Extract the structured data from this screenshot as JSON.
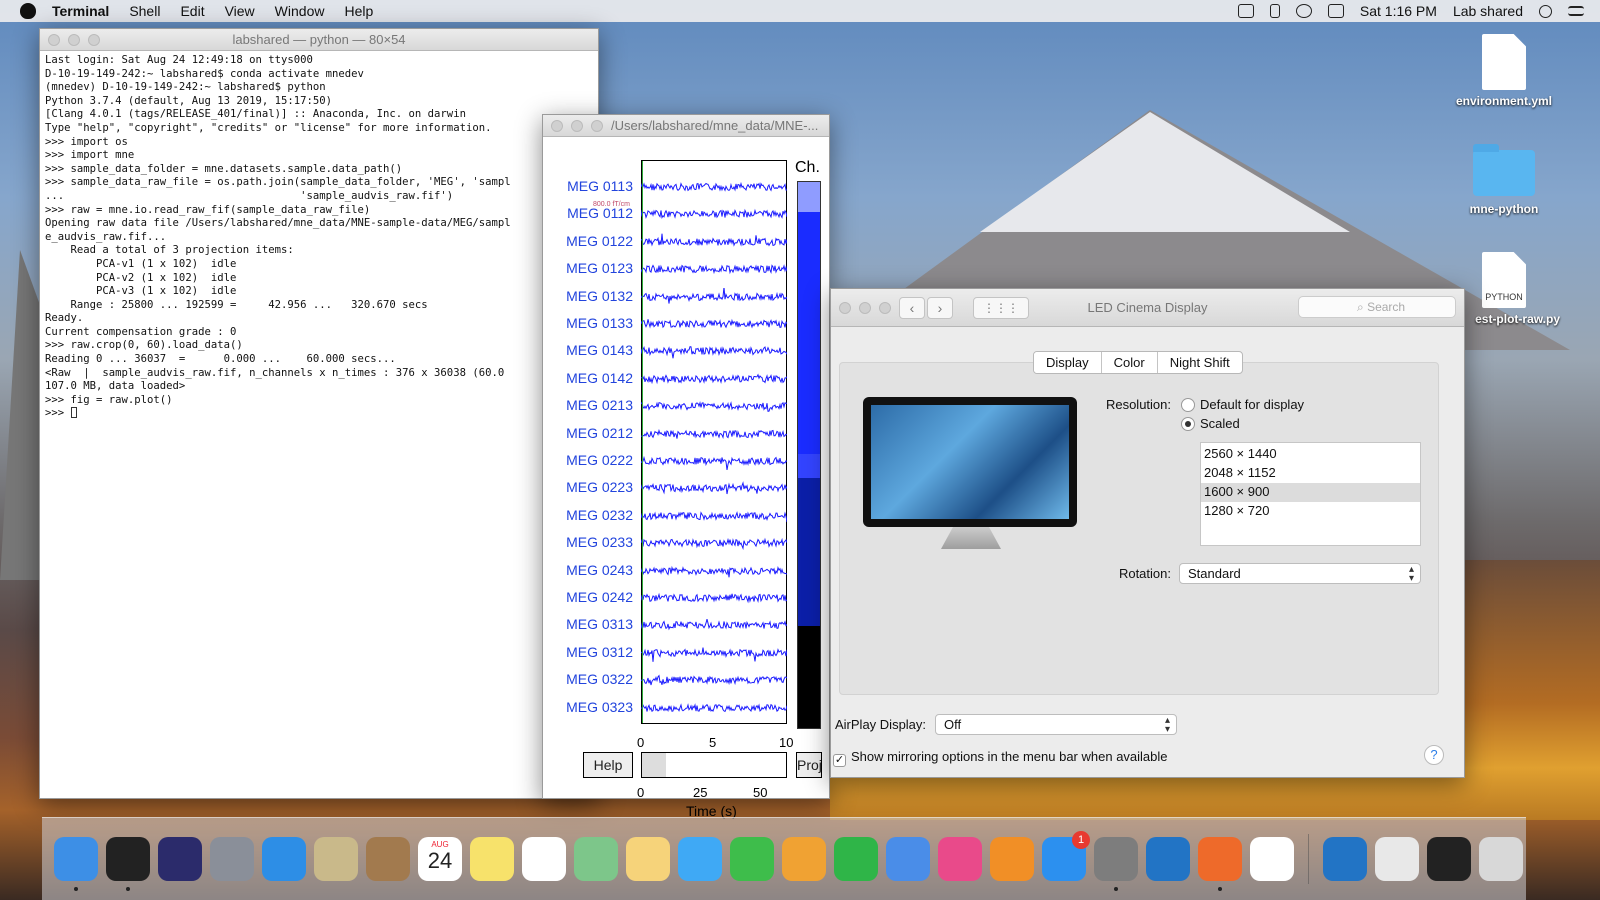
{
  "menubar": {
    "app_name": "Terminal",
    "items": [
      "Shell",
      "Edit",
      "View",
      "Window",
      "Help"
    ],
    "clock": "Sat 1:16 PM",
    "user": "Lab shared",
    "status_icons": [
      "shield-icon",
      "bluetooth-icon",
      "wifi-icon",
      "airplay-icon",
      "search-icon",
      "menu-list-icon"
    ]
  },
  "desktop": {
    "items": [
      {
        "label": "environment.yml",
        "icon": "file-icon"
      },
      {
        "label": "mne-python",
        "icon": "folder-icon"
      },
      {
        "label": "est-plot-raw.py",
        "icon": "python-file-icon",
        "tag": "PYTHON"
      }
    ]
  },
  "terminal": {
    "title": "labshared — python — 80×54",
    "lines": [
      "Last login: Sat Aug 24 12:49:18 on ttys000",
      "D-10-19-149-242:~ labshared$ conda activate mnedev",
      "(mnedev) D-10-19-149-242:~ labshared$ python",
      "Python 3.7.4 (default, Aug 13 2019, 15:17:50)",
      "[Clang 4.0.1 (tags/RELEASE_401/final)] :: Anaconda, Inc. on darwin",
      "Type \"help\", \"copyright\", \"credits\" or \"license\" for more information.",
      ">>> import os",
      ">>> import mne",
      ">>> sample_data_folder = mne.datasets.sample.data_path()",
      ">>> sample_data_raw_file = os.path.join(sample_data_folder, 'MEG', 'sampl",
      "...                                     'sample_audvis_raw.fif')",
      ">>> raw = mne.io.read_raw_fif(sample_data_raw_file)",
      "Opening raw data file /Users/labshared/mne_data/MNE-sample-data/MEG/sampl",
      "e_audvis_raw.fif...",
      "    Read a total of 3 projection items:",
      "        PCA-v1 (1 x 102)  idle",
      "        PCA-v2 (1 x 102)  idle",
      "        PCA-v3 (1 x 102)  idle",
      "    Range : 25800 ... 192599 =     42.956 ...   320.670 secs",
      "Ready.",
      "Current compensation grade : 0",
      ">>> raw.crop(0, 60).load_data()",
      "Reading 0 ... 36037  =      0.000 ...    60.000 secs...",
      "<Raw  |  sample_audvis_raw.fif, n_channels x n_times : 376 x 36038 (60.0",
      "107.0 MB, data loaded>",
      ">>> fig = raw.plot()",
      ">>> "
    ]
  },
  "mne_plot": {
    "title": "/Users/labshared/mne_data/MNE-...",
    "channels": [
      "MEG 0113",
      "MEG 0112",
      "MEG 0122",
      "MEG 0123",
      "MEG 0132",
      "MEG 0133",
      "MEG 0143",
      "MEG 0142",
      "MEG 0213",
      "MEG 0212",
      "MEG 0222",
      "MEG 0223",
      "MEG 0232",
      "MEG 0233",
      "MEG 0243",
      "MEG 0242",
      "MEG 0313",
      "MEG 0312",
      "MEG 0322",
      "MEG 0323"
    ],
    "scale_label": "800.0 fT/cm",
    "channel_header": "Ch.",
    "top_ticks": [
      "0",
      "5",
      "10"
    ],
    "bottom_ticks": [
      "0",
      "25",
      "50"
    ],
    "xlabel": "Time (s)",
    "help_label": "Help",
    "proj_label": "Proj",
    "trace_color": "#1a1aff"
  },
  "displays": {
    "title": "LED Cinema Display",
    "search_placeholder": "Search",
    "tabs": [
      "Display",
      "Color",
      "Night Shift"
    ],
    "active_tab": "Display",
    "resolution_label": "Resolution:",
    "resolution_options": [
      {
        "label": "Default for display",
        "checked": false
      },
      {
        "label": "Scaled",
        "checked": true
      }
    ],
    "resolutions": [
      "2560 × 1440",
      "2048 × 1152",
      "1600 × 900",
      "1280 × 720"
    ],
    "selected_resolution": "1600 × 900",
    "rotation_label": "Rotation:",
    "rotation_value": "Standard",
    "airplay_label": "AirPlay Display:",
    "airplay_value": "Off",
    "mirroring_label": "Show mirroring options in the menu bar when available",
    "mirroring_checked": true,
    "help": "?"
  },
  "dock": {
    "apps": [
      {
        "name": "finder-icon",
        "color": "#3d8fe6",
        "running": true
      },
      {
        "name": "terminal-icon",
        "color": "#222222",
        "running": true
      },
      {
        "name": "siri-icon",
        "color": "#2b2b6b",
        "running": false
      },
      {
        "name": "launchpad-icon",
        "color": "#8a8f99",
        "running": false
      },
      {
        "name": "safari-icon",
        "color": "#2d8ee6",
        "running": false
      },
      {
        "name": "mail-icon",
        "color": "#c9b98a",
        "running": false
      },
      {
        "name": "contacts-icon",
        "color": "#a27a4e",
        "running": false
      },
      {
        "name": "calendar-icon",
        "color": "#ffffff",
        "running": false
      },
      {
        "name": "notes-icon",
        "color": "#f7e26b",
        "running": false
      },
      {
        "name": "reminders-icon",
        "color": "#ffffff",
        "running": false
      },
      {
        "name": "maps-icon",
        "color": "#7dc68a",
        "running": false
      },
      {
        "name": "photos-icon",
        "color": "#f6d37a",
        "running": false
      },
      {
        "name": "messages-icon",
        "color": "#3fa9f5",
        "running": false
      },
      {
        "name": "facetime-icon",
        "color": "#3ebd4b",
        "running": false
      },
      {
        "name": "pages-icon",
        "color": "#f0a233",
        "running": false
      },
      {
        "name": "numbers-icon",
        "color": "#2fb548",
        "running": false
      },
      {
        "name": "keynote-icon",
        "color": "#4a8de8",
        "running": false
      },
      {
        "name": "itunes-icon",
        "color": "#e94a8a",
        "running": false
      },
      {
        "name": "ibooks-icon",
        "color": "#f18f26",
        "running": false
      },
      {
        "name": "app-store-icon",
        "color": "#2c90ef",
        "running": false,
        "badge": "1"
      },
      {
        "name": "system-preferences-icon",
        "color": "#7d7d7d",
        "running": true
      },
      {
        "name": "vscode-icon",
        "color": "#2274c5",
        "running": false
      },
      {
        "name": "firefox-icon",
        "color": "#ee6a2a",
        "running": true
      },
      {
        "name": "document-icon",
        "color": "#ffffff",
        "running": false
      }
    ],
    "trash_side": [
      {
        "name": "vscode-doc-icon",
        "color": "#2274c5"
      },
      {
        "name": "preview-icon",
        "color": "#e8e8e8"
      },
      {
        "name": "terminal-doc-icon",
        "color": "#222222"
      },
      {
        "name": "trash-icon",
        "color": "#d8d8d8"
      }
    ],
    "calendar_month": "AUG",
    "calendar_day": "24"
  }
}
